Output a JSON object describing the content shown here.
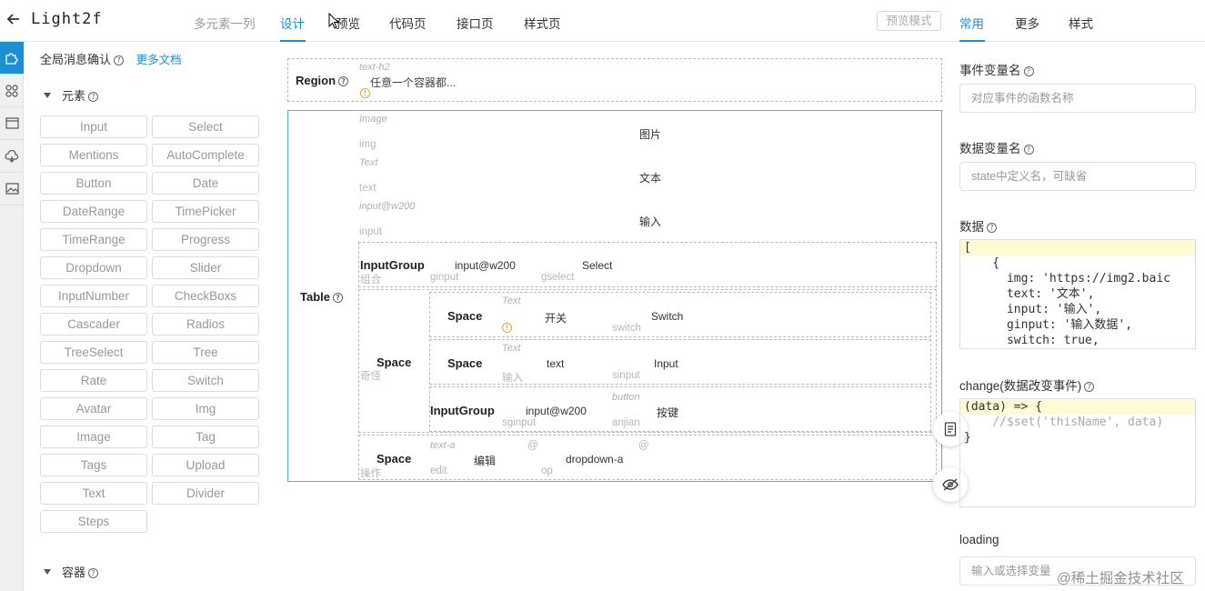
{
  "app": {
    "title": "Light2f",
    "tabs": [
      "多元素一列",
      "设计",
      "预览",
      "代码页",
      "接口页",
      "样式页"
    ],
    "preview_mode": "预览模式",
    "accent_color": "#1a8fd6"
  },
  "sidebar": {
    "icons": [
      "puzzle-icon",
      "grid-icon",
      "window-icon",
      "cloud-icon",
      "image-icon"
    ],
    "global_confirm": "全局消息确认",
    "more_docs": "更多文档",
    "elements_title": "元素",
    "containers_title": "容器",
    "components": [
      "Input",
      "Select",
      "Mentions",
      "AutoComplete",
      "Button",
      "Date",
      "DateRange",
      "TimePicker",
      "TimeRange",
      "Progress",
      "Dropdown",
      "Slider",
      "InputNumber",
      "CheckBoxs",
      "Cascader",
      "Radios",
      "TreeSelect",
      "Tree",
      "Rate",
      "Switch",
      "Avatar",
      "Img",
      "Image",
      "Tag",
      "Tags",
      "Upload",
      "Text",
      "Divider",
      "Steps"
    ]
  },
  "canvas": {
    "region": {
      "label": "Region",
      "hint": "text-h2",
      "content": "任意一个容器都..."
    },
    "table": {
      "label": "Table",
      "rows": [
        {
          "hint": "Image",
          "sub": "img",
          "value": "图片"
        },
        {
          "hint": "Text",
          "sub": "text",
          "value": "文本"
        },
        {
          "hint": "input@w200",
          "sub": "input",
          "value": "输入"
        }
      ],
      "input_group1": {
        "label": "InputGroup",
        "sublabel": "组合",
        "input": "input@w200",
        "input_sub": "ginput",
        "select": "Select",
        "select_sub": "gselect"
      },
      "space": {
        "label": "Space",
        "sublabel": "奇怪",
        "space1": {
          "label": "Space",
          "hint": "Text",
          "text": "开关",
          "switch": "Switch",
          "switch_sub": "switch"
        },
        "space2": {
          "label": "Space",
          "hint": "Text",
          "text": "text",
          "sub": "输入",
          "input": "Input",
          "input_sub": "sinput"
        },
        "input_group2": {
          "label": "InputGroup",
          "input": "input@w200",
          "input_sub": "sginput",
          "hint": "button",
          "button": "按键",
          "button_sub": "anjian"
        }
      },
      "ops": {
        "label": "Space",
        "sublabel": "操作",
        "hint": "text-a",
        "sub": "edit",
        "edit": "编辑",
        "at1": "@",
        "at2": "@",
        "dropdown": "dropdown-a",
        "dropdown_sub": "op"
      }
    }
  },
  "right_panel": {
    "tabs": [
      "常用",
      "更多",
      "样式"
    ],
    "event_var_label": "事件变量名",
    "event_var_placeholder": "对应事件的函数名称",
    "data_var_label": "数据变量名",
    "data_var_placeholder": "state中定义名，可缺省",
    "data_label": "数据",
    "data_code": [
      "[",
      "    {",
      "      img: 'https://img2.baic",
      "      text: '文本',",
      "      input: '输入',",
      "      ginput: '输入数据',",
      "      switch: true,"
    ],
    "change_label": "change(数据改变事件)",
    "change_code": [
      "(data) => {",
      "    //$set('thisName', data)",
      "}"
    ],
    "loading_label": "loading",
    "loading_placeholder": "输入或选择变量"
  },
  "watermark": "@稀土掘金技术社区"
}
